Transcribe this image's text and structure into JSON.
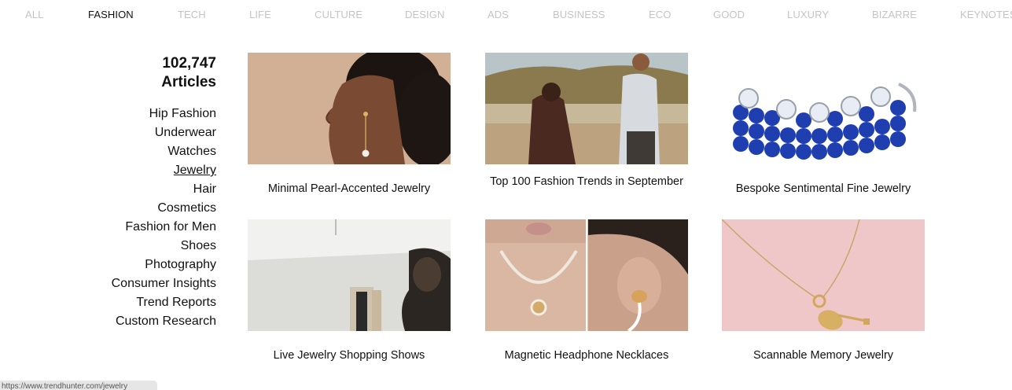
{
  "nav": {
    "tabs": [
      "ALL",
      "FASHION",
      "TECH",
      "LIFE",
      "CULTURE",
      "DESIGN",
      "ADS",
      "BUSINESS",
      "ECO",
      "GOOD",
      "LUXURY",
      "BIZARRE",
      "KEYNOTES"
    ],
    "active": "FASHION"
  },
  "sidebar": {
    "count": "102,747",
    "count_label": "Articles",
    "categories": [
      "Hip Fashion",
      "Underwear",
      "Watches",
      "Jewelry",
      "Hair",
      "Cosmetics",
      "Fashion for Men",
      "Shoes",
      "Photography",
      "Consumer Insights",
      "Trend Reports",
      "Custom Research"
    ],
    "active_category": "Jewelry"
  },
  "articles": [
    {
      "title": "Minimal Pearl-Accented Jewelry",
      "image": "woman-profile-earring"
    },
    {
      "title": "Top 100 Fashion Trends in September",
      "image": "two-men-lakeside"
    },
    {
      "title": "Bespoke Sentimental Fine Jewelry",
      "image": "blue-bead-bracelets"
    },
    {
      "title": "Live Jewelry Shopping Shows",
      "image": "room-interior"
    },
    {
      "title": "Magnetic Headphone Necklaces",
      "image": "necklace-earbud"
    },
    {
      "title": "Scannable Memory Jewelry",
      "image": "key-pendant-pink"
    }
  ],
  "status": {
    "url": "https://www.trendhunter.com/jewelry"
  },
  "colors": {
    "tab_inactive": "#c4c4c4",
    "text": "#111111",
    "status_bg": "#e6e6e6"
  }
}
